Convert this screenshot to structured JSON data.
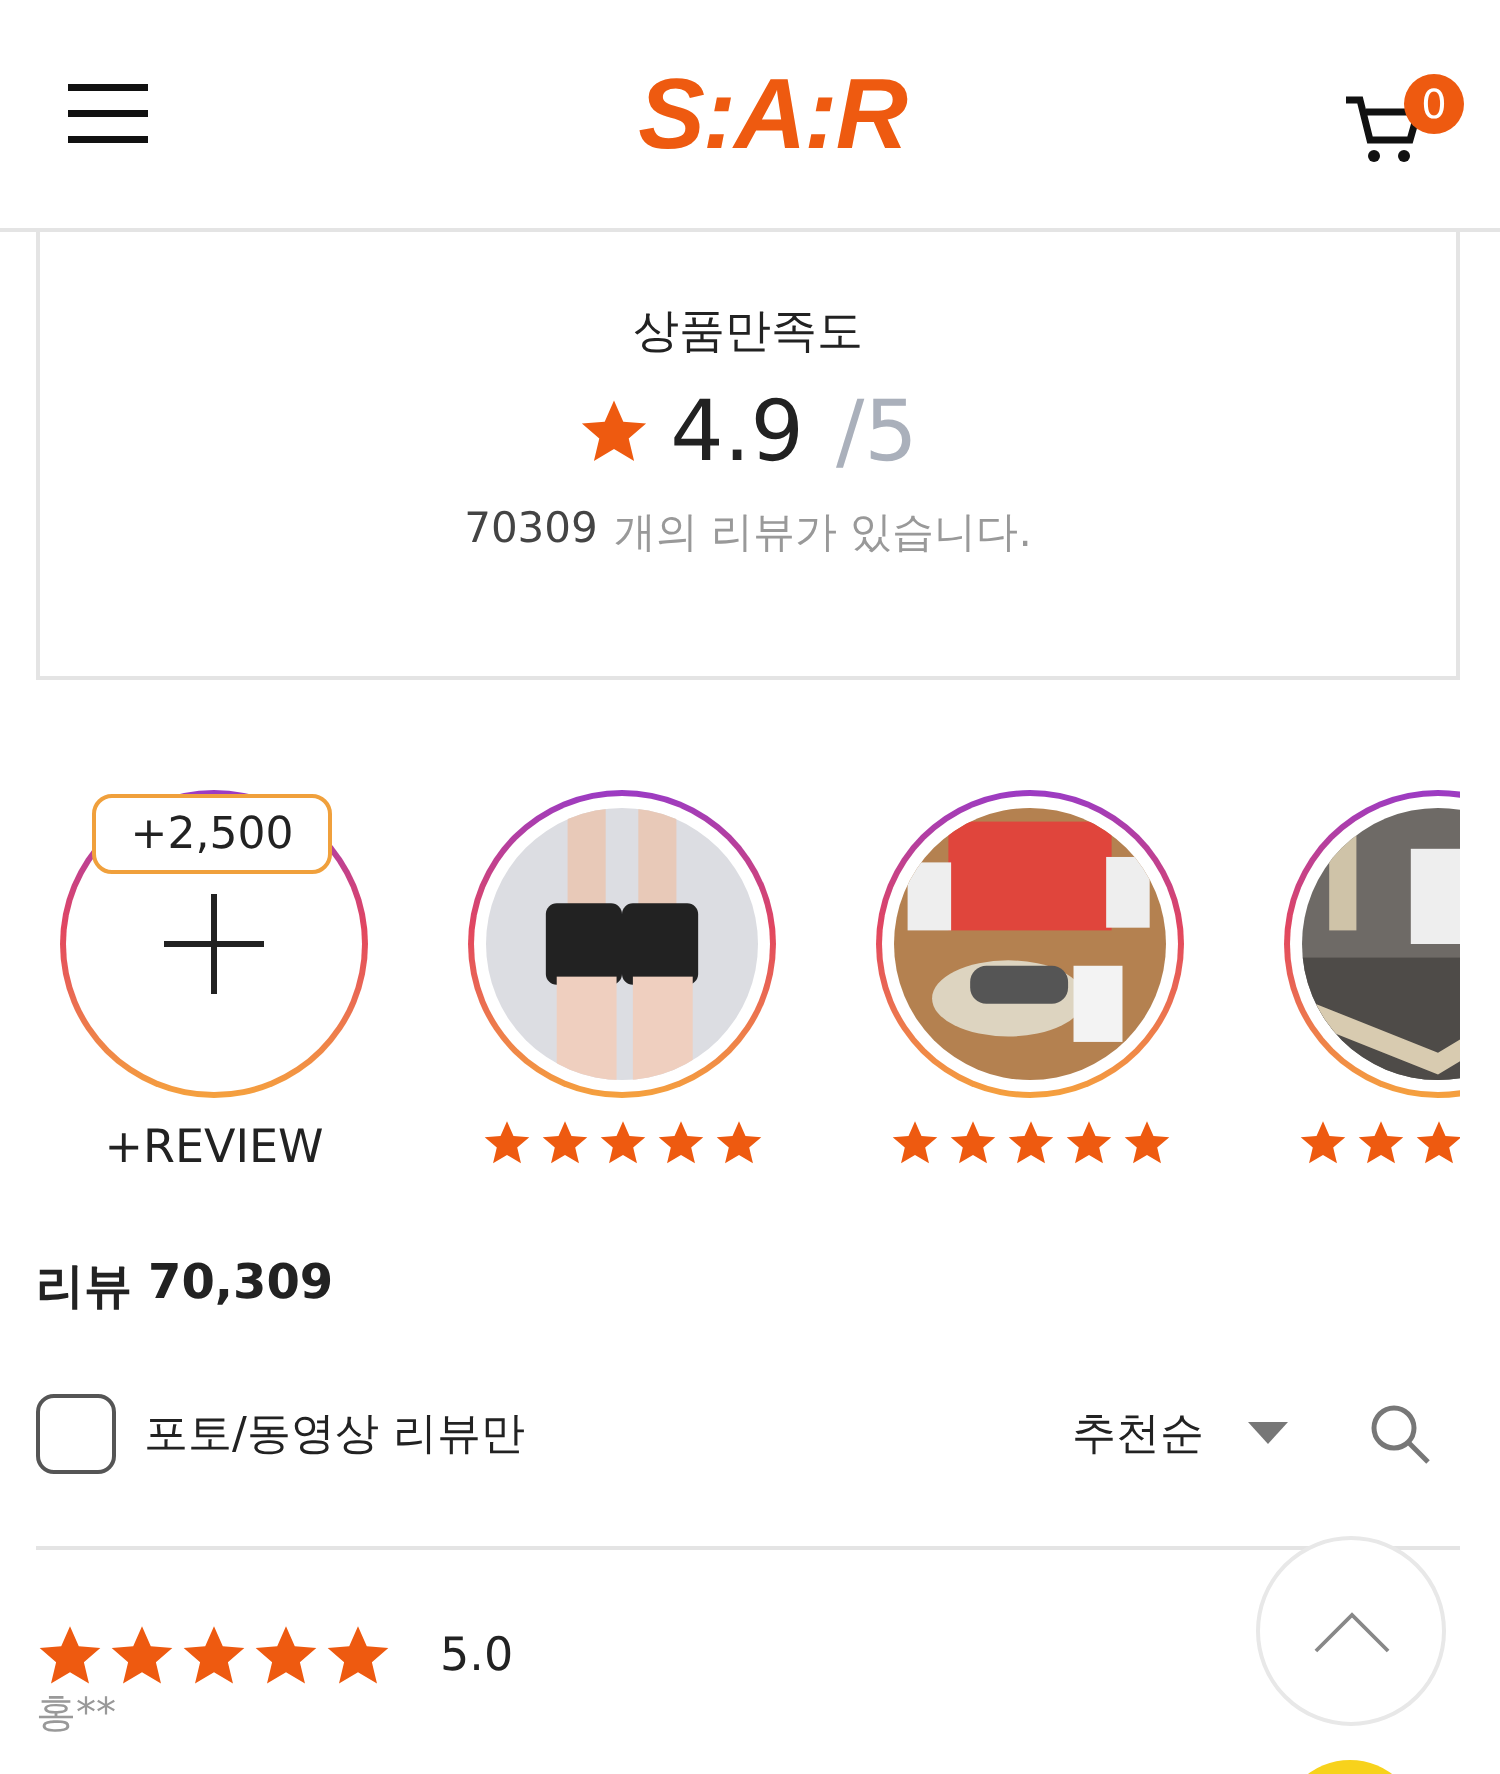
{
  "header": {
    "logo": "S:A:R",
    "cart_count": "0"
  },
  "summary": {
    "title": "상품만족도",
    "score": "4.9",
    "max": "/5",
    "count": "70309",
    "count_suffix": "개의 리뷰가 있습니다."
  },
  "stories": [
    {
      "kind": "add",
      "badge": "+2,500",
      "label": "+REVIEW"
    },
    {
      "stars": 5
    },
    {
      "stars": 5
    },
    {
      "stars": 3
    }
  ],
  "review_heading": {
    "label": "리뷰",
    "count": "70,309"
  },
  "filter": {
    "label": "포토/동영상 리뷰만",
    "checked": false,
    "sort": "추천순"
  },
  "reviews": [
    {
      "stars": 5,
      "score": "5.0",
      "author": "홍**"
    }
  ]
}
